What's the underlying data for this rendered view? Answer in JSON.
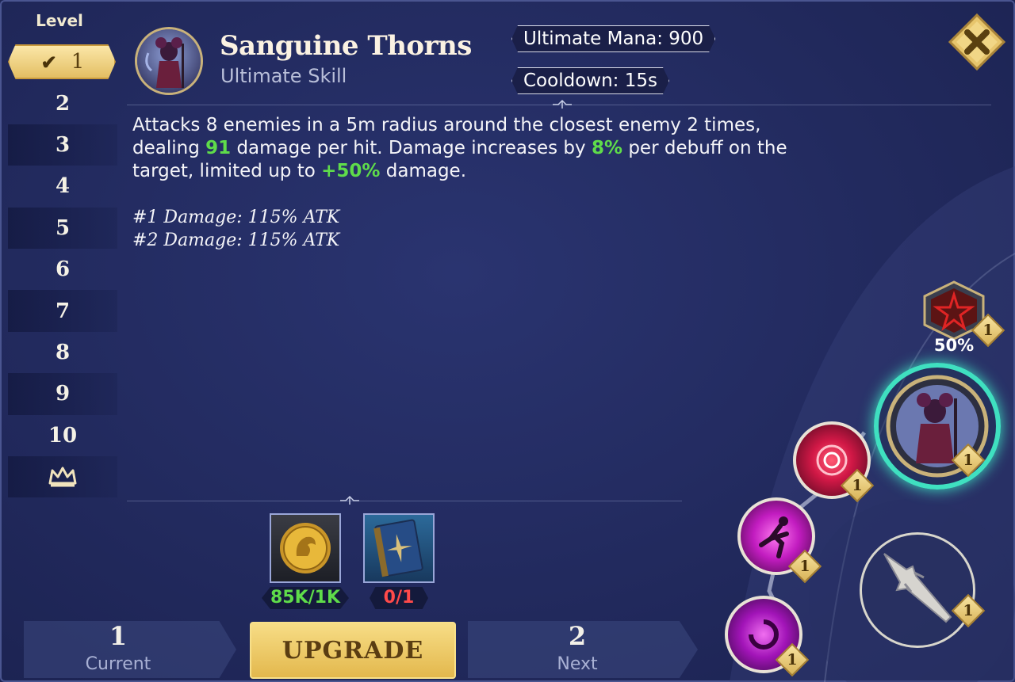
{
  "sidebar": {
    "title": "Level",
    "levels": [
      "1",
      "2",
      "3",
      "4",
      "5",
      "6",
      "7",
      "8",
      "9",
      "10"
    ],
    "selected_index": 0,
    "crown_icon": "crown-icon"
  },
  "header": {
    "skill_name": "Sanguine Thorns",
    "skill_type": "Ultimate Skill",
    "ultimate_mana": "Ultimate Mana: 900",
    "cooldown": "Cooldown: 15s"
  },
  "description": {
    "line1": "Attacks 8 enemies in a 5m radius around the closest enemy 2 times,",
    "line2_a": "dealing ",
    "line2_v1": "91",
    "line2_b": " damage per hit. Damage increases by ",
    "line2_v2": "8%",
    "line2_c": " per debuff on the",
    "line3_a": "target, limited up to ",
    "line3_v": "+50%",
    "line3_b": " damage.",
    "damage1": "#1 Damage: 115% ATK",
    "damage2": "#2 Damage: 115% ATK"
  },
  "costs": {
    "gold": {
      "label": "85K/1K",
      "icon": "gold-coin-icon",
      "color": "#5fdc4a"
    },
    "book": {
      "label": "0/1",
      "icon": "skill-book-icon",
      "color": "#ff4a4a"
    }
  },
  "bottom": {
    "current_value": "1",
    "current_label": "Current",
    "upgrade_label": "UPGRADE",
    "next_value": "2",
    "next_label": "Next"
  },
  "tree": {
    "star_node_level": "1",
    "star_node_percent": "50%",
    "ultimate_node_level": "1",
    "node_red_level": "1",
    "node_magenta_level": "1",
    "node_purple_level": "1",
    "spear_node_level": "1"
  },
  "colors": {
    "accent_gold": "#e3be63",
    "highlight_green": "#5fdc4a",
    "panel_bg": "#222a5e",
    "selected_ring": "#3fe0c0"
  }
}
